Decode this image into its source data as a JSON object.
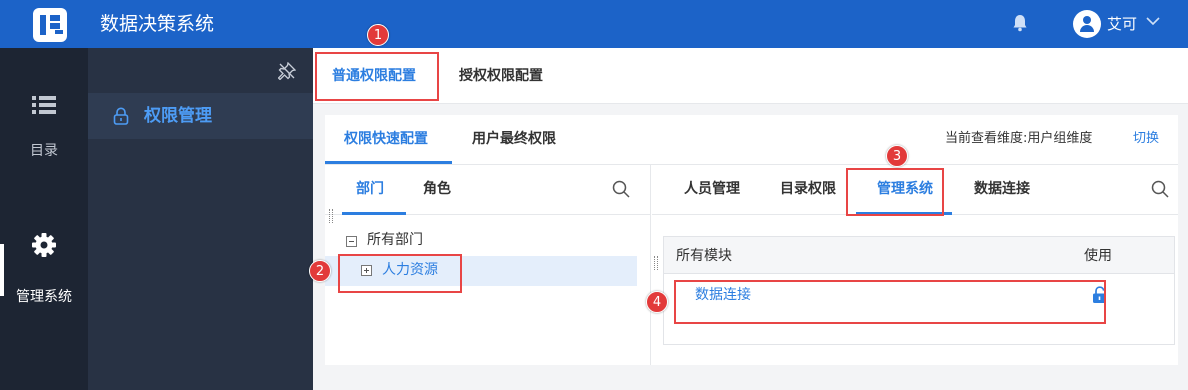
{
  "header": {
    "app_title": "数据决策系统",
    "user_name": "艾可"
  },
  "rail": {
    "items": [
      {
        "label": "目录"
      },
      {
        "label": "管理系统"
      }
    ]
  },
  "sidebar": {
    "items": [
      {
        "label": "权限管理"
      }
    ]
  },
  "top_tabs": [
    {
      "label": "普通权限配置"
    },
    {
      "label": "授权权限配置"
    }
  ],
  "sub_tabs": [
    {
      "label": "权限快速配置"
    },
    {
      "label": "用户最终权限"
    }
  ],
  "dimension": {
    "text": "当前查看维度:用户组维度",
    "switch_label": "切换"
  },
  "left_pane": {
    "tabs": [
      {
        "label": "部门"
      },
      {
        "label": "角色"
      }
    ],
    "tree": [
      {
        "label": "所有部门"
      },
      {
        "label": "人力资源"
      }
    ]
  },
  "right_pane": {
    "tabs": [
      {
        "label": "人员管理"
      },
      {
        "label": "目录权限"
      },
      {
        "label": "管理系统"
      },
      {
        "label": "数据连接"
      }
    ],
    "table": {
      "headers": [
        "所有模块",
        "使用"
      ],
      "rows": [
        {
          "module": "数据连接"
        }
      ]
    }
  },
  "annotations": [
    "1",
    "2",
    "3",
    "4"
  ],
  "colors": {
    "topbar": "#1c63c8",
    "accent": "#2c7ee0",
    "marker": "#e84545"
  }
}
